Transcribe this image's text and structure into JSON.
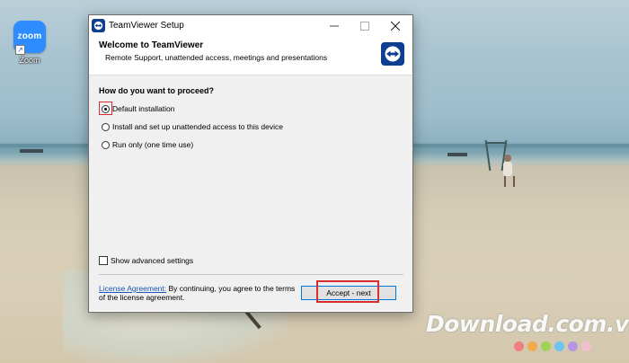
{
  "desktop": {
    "shortcut": {
      "label": "Zoom",
      "icon": "zoom-app-icon",
      "tile_text": "zoom"
    },
    "watermark": {
      "text": "Download.com.vn",
      "dot_colors": [
        "#f08080",
        "#f5a94d",
        "#9fd356",
        "#6ec3f0",
        "#b794e4",
        "#f1c0d0"
      ]
    }
  },
  "dialog": {
    "title": "TeamViewer Setup",
    "header": {
      "title": "Welcome to TeamViewer",
      "subtitle": "Remote Support, unattended access, meetings and presentations"
    },
    "question": "How do you want to proceed?",
    "options": [
      {
        "label": "Default installation",
        "selected": true
      },
      {
        "label": "Install and set up unattended access to this device",
        "selected": false
      },
      {
        "label": "Run only (one time use)",
        "selected": false
      }
    ],
    "advanced_label": "Show advanced settings",
    "advanced_checked": false,
    "license_link": "License Agreement:",
    "license_text": " By continuing, you agree to the terms of the license agreement.",
    "accept_label": "Accept - next",
    "window_buttons": {
      "minimize": "minimize-icon",
      "maximize": "maximize-icon",
      "close": "close-icon"
    },
    "colors": {
      "accent": "#0078d7",
      "brand": "#0e3e90",
      "highlight": "#d92c2c"
    }
  }
}
